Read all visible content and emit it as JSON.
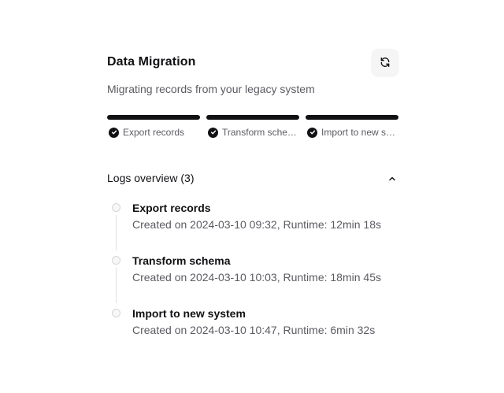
{
  "card": {
    "title": "Data Migration",
    "subtitle": "Migrating records from your legacy system",
    "refresh_icon": "refresh-icon"
  },
  "steps": [
    {
      "label": "Export records",
      "status": "completed"
    },
    {
      "label": "Transform schema",
      "status": "completed"
    },
    {
      "label": "Import to new system",
      "status": "completed"
    }
  ],
  "logs": {
    "title": "Logs overview (3)",
    "collapse_icon": "chevron-up-icon",
    "items": [
      {
        "title": "Export records",
        "meta": "Created on 2024-03-10 09:32, Runtime: 12min 18s"
      },
      {
        "title": "Transform schema",
        "meta": "Created on 2024-03-10 10:03, Runtime: 18min 45s"
      },
      {
        "title": "Import to new system",
        "meta": "Created on 2024-03-10 10:47, Runtime: 6min 32s"
      }
    ]
  },
  "colors": {
    "primary": "#111114",
    "muted_text": "#5b5b63",
    "button_bg": "#f5f5f6",
    "timeline_line": "#e2e2e5"
  }
}
